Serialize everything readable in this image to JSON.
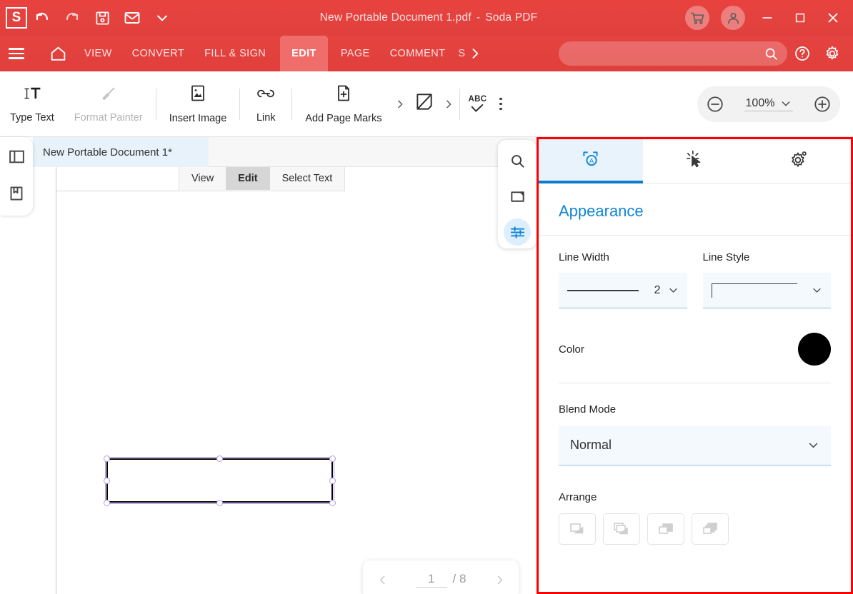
{
  "titlebar": {
    "logo": "S",
    "document_title": "New Portable Document 1.pdf",
    "separator": "-",
    "app_name": "Soda PDF",
    "icons": [
      "undo-icon",
      "redo-icon",
      "save-icon",
      "email-icon",
      "chevron-down-icon"
    ],
    "cart_icon": "shopping-cart-icon",
    "account_icon": "account-icon",
    "minimize": "minimize-icon",
    "maximize": "maximize-icon",
    "close": "close-icon"
  },
  "menubar": {
    "menu_icon": "hamburger-icon",
    "home_icon": "home-icon",
    "items": [
      {
        "label": "VIEW",
        "active": false
      },
      {
        "label": "CONVERT",
        "active": false
      },
      {
        "label": "FILL & SIGN",
        "active": false
      },
      {
        "label": "EDIT",
        "active": true
      },
      {
        "label": "PAGE",
        "active": false
      },
      {
        "label": "COMMENT",
        "active": false
      }
    ],
    "truncated_item": "S",
    "more_icon": "chevron-right-icon",
    "search": {
      "value": "",
      "placeholder": ""
    },
    "help_icon": "help-icon",
    "settings_icon": "gear-icon"
  },
  "ribbon": {
    "tools": [
      {
        "label": "Type Text",
        "icon": "type-text-icon",
        "disabled": false
      },
      {
        "label": "Format Painter",
        "icon": "format-painter-icon",
        "disabled": true
      },
      {
        "label": "Insert Image",
        "icon": "insert-image-icon",
        "disabled": false
      },
      {
        "label": "Link",
        "icon": "link-icon",
        "disabled": false
      },
      {
        "label": "Add Page Marks",
        "icon": "add-page-marks-icon",
        "disabled": false
      }
    ],
    "watermark_icon": "watermark-icon",
    "spellcheck_icon": "abc-spellcheck-icon",
    "spellcheck_label": "ABC",
    "overflow_icon": "kebab-menu-icon",
    "zoom": {
      "minus_icon": "zoom-out-icon",
      "value": "100%",
      "dropdown_icon": "chevron-down-icon",
      "plus_icon": "zoom-in-icon"
    }
  },
  "workspace": {
    "left_rail": [
      {
        "icon": "panel-toggle-icon"
      },
      {
        "icon": "bookmark-icon"
      }
    ],
    "document_tab": "New Portable Document 1*",
    "modes": [
      {
        "label": "View",
        "active": false
      },
      {
        "label": "Edit",
        "active": true
      },
      {
        "label": "Select Text",
        "active": false
      }
    ],
    "float_tools": [
      {
        "icon": "search-icon",
        "active": false
      },
      {
        "icon": "pages-panel-icon",
        "active": false
      },
      {
        "icon": "properties-sliders-icon",
        "active": true
      }
    ],
    "page_nav": {
      "prev_icon": "chevron-left-icon",
      "current_page": "1",
      "total_pages": "/ 8",
      "next_icon": "chevron-right-icon"
    },
    "selected_shape": {
      "type": "rectangle",
      "stroke_color": "#000000",
      "selection_color": "#b49ae6",
      "handles": 8
    }
  },
  "properties_panel": {
    "highlight_border_color": "#ff0000",
    "tabs": [
      {
        "icon": "appearance-icon",
        "active": true
      },
      {
        "icon": "action-cursor-icon",
        "active": false
      },
      {
        "icon": "settings-gear-icon",
        "active": false
      }
    ],
    "title": "Appearance",
    "line_width": {
      "label": "Line Width",
      "value": "2",
      "dropdown_icon": "chevron-down-icon"
    },
    "line_style": {
      "label": "Line Style",
      "value": "corner-line",
      "dropdown_icon": "chevron-down-icon"
    },
    "color": {
      "label": "Color",
      "value": "#000000"
    },
    "blend_mode": {
      "label": "Blend Mode",
      "value": "Normal",
      "dropdown_icon": "chevron-down-icon"
    },
    "arrange": {
      "label": "Arrange",
      "buttons": [
        {
          "icon": "bring-forward-icon",
          "disabled": true
        },
        {
          "icon": "bring-to-front-icon",
          "disabled": true
        },
        {
          "icon": "send-backward-icon",
          "disabled": true
        },
        {
          "icon": "send-to-back-icon",
          "disabled": true
        }
      ]
    }
  }
}
